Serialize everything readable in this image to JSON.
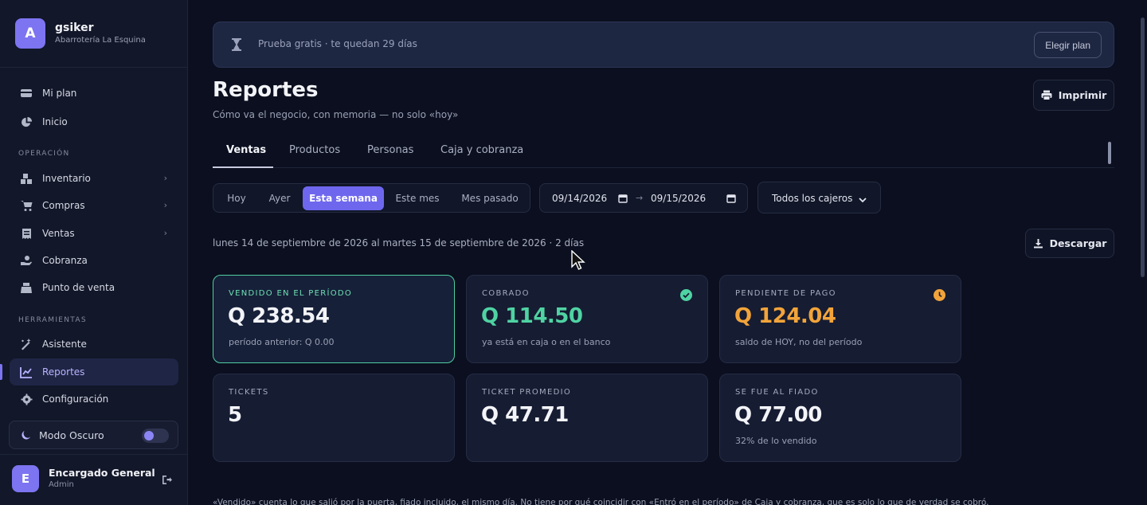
{
  "brand": {
    "initial": "A",
    "name": "gsiker",
    "subtitle": "Abarrotería La Esquina"
  },
  "sidebar": {
    "top_items": [
      {
        "label": "Mi plan",
        "icon": "card-icon"
      },
      {
        "label": "Inicio",
        "icon": "pie-chart-icon"
      }
    ],
    "section_operacion": "OPERACIÓN",
    "operacion_items": [
      {
        "label": "Inventario",
        "icon": "boxes-icon",
        "has_submenu": true
      },
      {
        "label": "Compras",
        "icon": "cart-icon",
        "has_submenu": true
      },
      {
        "label": "Ventas",
        "icon": "receipt-icon",
        "has_submenu": true
      },
      {
        "label": "Cobranza",
        "icon": "hand-coin-icon",
        "has_submenu": false
      },
      {
        "label": "Punto de venta",
        "icon": "cash-register-icon",
        "has_submenu": false
      }
    ],
    "section_herramientas": "HERRAMIENTAS",
    "herramientas_items": [
      {
        "label": "Asistente",
        "icon": "magic-wand-icon"
      },
      {
        "label": "Reportes",
        "icon": "bar-chart-icon",
        "active": true
      },
      {
        "label": "Configuración",
        "icon": "gear-icon"
      }
    ],
    "dark_mode_label": "Modo Oscuro",
    "dark_mode_on": false
  },
  "user": {
    "initial": "E",
    "name": "Encargado General",
    "role": "Admin"
  },
  "trial": {
    "text": "Prueba gratis · te quedan 29 días",
    "button": "Elegir plan"
  },
  "page": {
    "title": "Reportes",
    "subtitle": "Cómo va el negocio, con memoria — no solo «hoy»",
    "print_label": "Imprimir",
    "download_label": "Descargar"
  },
  "tabs": [
    {
      "label": "Ventas",
      "active": true
    },
    {
      "label": "Productos"
    },
    {
      "label": "Personas"
    },
    {
      "label": "Caja y cobranza"
    }
  ],
  "periods": [
    {
      "label": "Hoy"
    },
    {
      "label": "Ayer"
    },
    {
      "label": "Esta semana",
      "active": true
    },
    {
      "label": "Este mes"
    },
    {
      "label": "Mes pasado"
    }
  ],
  "date_range": {
    "from": "09/14/2026",
    "to": "09/15/2026",
    "separator": "→"
  },
  "cashier_filter": "Todos los cajeros",
  "range_text": "lunes 14 de septiembre de 2026 al martes 15 de septiembre de 2026 · 2 días",
  "cards": [
    {
      "label": "VENDIDO EN EL PERÍODO",
      "value": "Q 238.54",
      "sub": "período anterior: Q 0.00",
      "color": "#f3f4f8"
    },
    {
      "label": "COBRADO",
      "value": "Q 114.50",
      "sub": "ya está en caja o en el banco",
      "color": "#4fd3a3",
      "badge": "check-circle-icon"
    },
    {
      "label": "PENDIENTE DE PAGO",
      "value": "Q 124.04",
      "sub": "saldo de HOY, no del período",
      "color": "#f2a43a",
      "badge": "clock-icon"
    },
    {
      "label": "TICKETS",
      "value": "5",
      "sub": ""
    },
    {
      "label": "TICKET PROMEDIO",
      "value": "Q 47.71",
      "sub": ""
    },
    {
      "label": "SE FUE AL FIADO",
      "value": "Q 77.00",
      "sub": "32% de lo vendido"
    }
  ],
  "footnote": "«Vendido» cuenta lo que salió por la puerta, fiado incluido, el mismo día. No tiene por qué coincidir con «Entró en el período» de Caja y cobranza, que es solo lo que de verdad se cobró."
}
